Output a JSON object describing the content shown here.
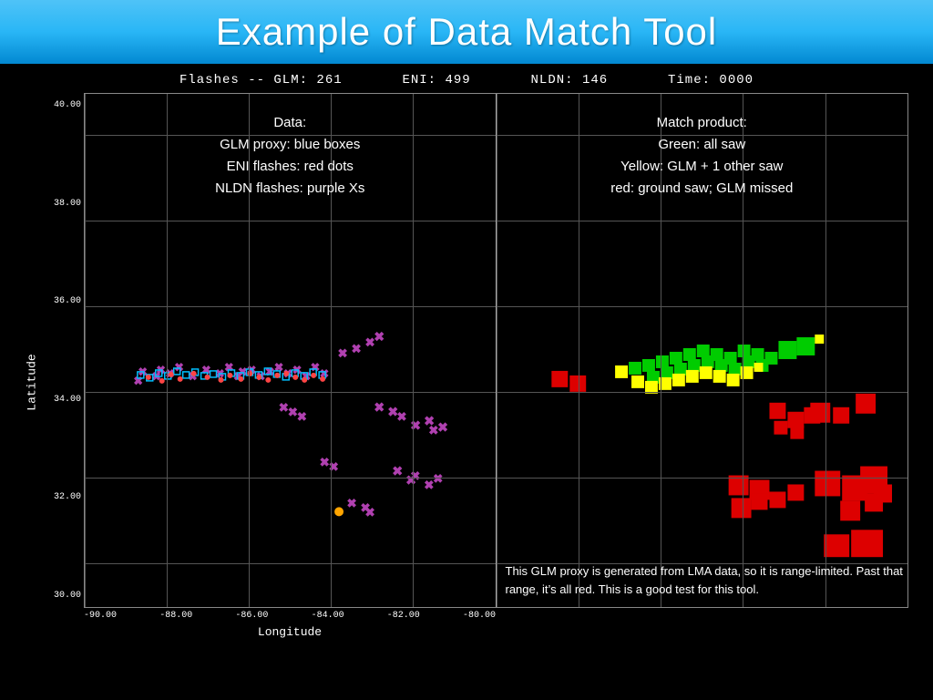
{
  "header": {
    "title": "Example of Data Match Tool"
  },
  "stats": {
    "label": "Flashes",
    "glm_label": "GLM:",
    "glm_value": "261",
    "eni_label": "ENI:",
    "eni_value": "499",
    "nldn_label": "NLDN:",
    "nldn_value": "146",
    "time_label": "Time:",
    "time_value": "0000"
  },
  "left_annotation": {
    "line1": "Data:",
    "line2": "GLM proxy: blue boxes",
    "line3": "ENI flashes: red dots",
    "line4": "NLDN flashes: purple Xs"
  },
  "right_annotation": {
    "line1": "Match product:",
    "line2": "Green: all saw",
    "line3": "Yellow: GLM + 1 other saw",
    "line4": "red: ground saw; GLM missed"
  },
  "bottom_text": {
    "text": "This GLM proxy is generated from LMA data, so it is range-limited. Past that range, it’s all red. This is a good test for this tool."
  },
  "y_axis": {
    "label": "Latitude",
    "ticks": [
      "40.00",
      "38.00",
      "36.00",
      "34.00",
      "32.00",
      "30.00"
    ]
  },
  "x_axis": {
    "label": "Longitude",
    "ticks": [
      "-90.00",
      "-88.00",
      "-86.00",
      "-84.00",
      "-82.00",
      "-80.00"
    ]
  },
  "colors": {
    "header_top": "#4fc3f7",
    "header_bottom": "#0288d1",
    "background": "#000000",
    "accent": "#29b6f6"
  }
}
